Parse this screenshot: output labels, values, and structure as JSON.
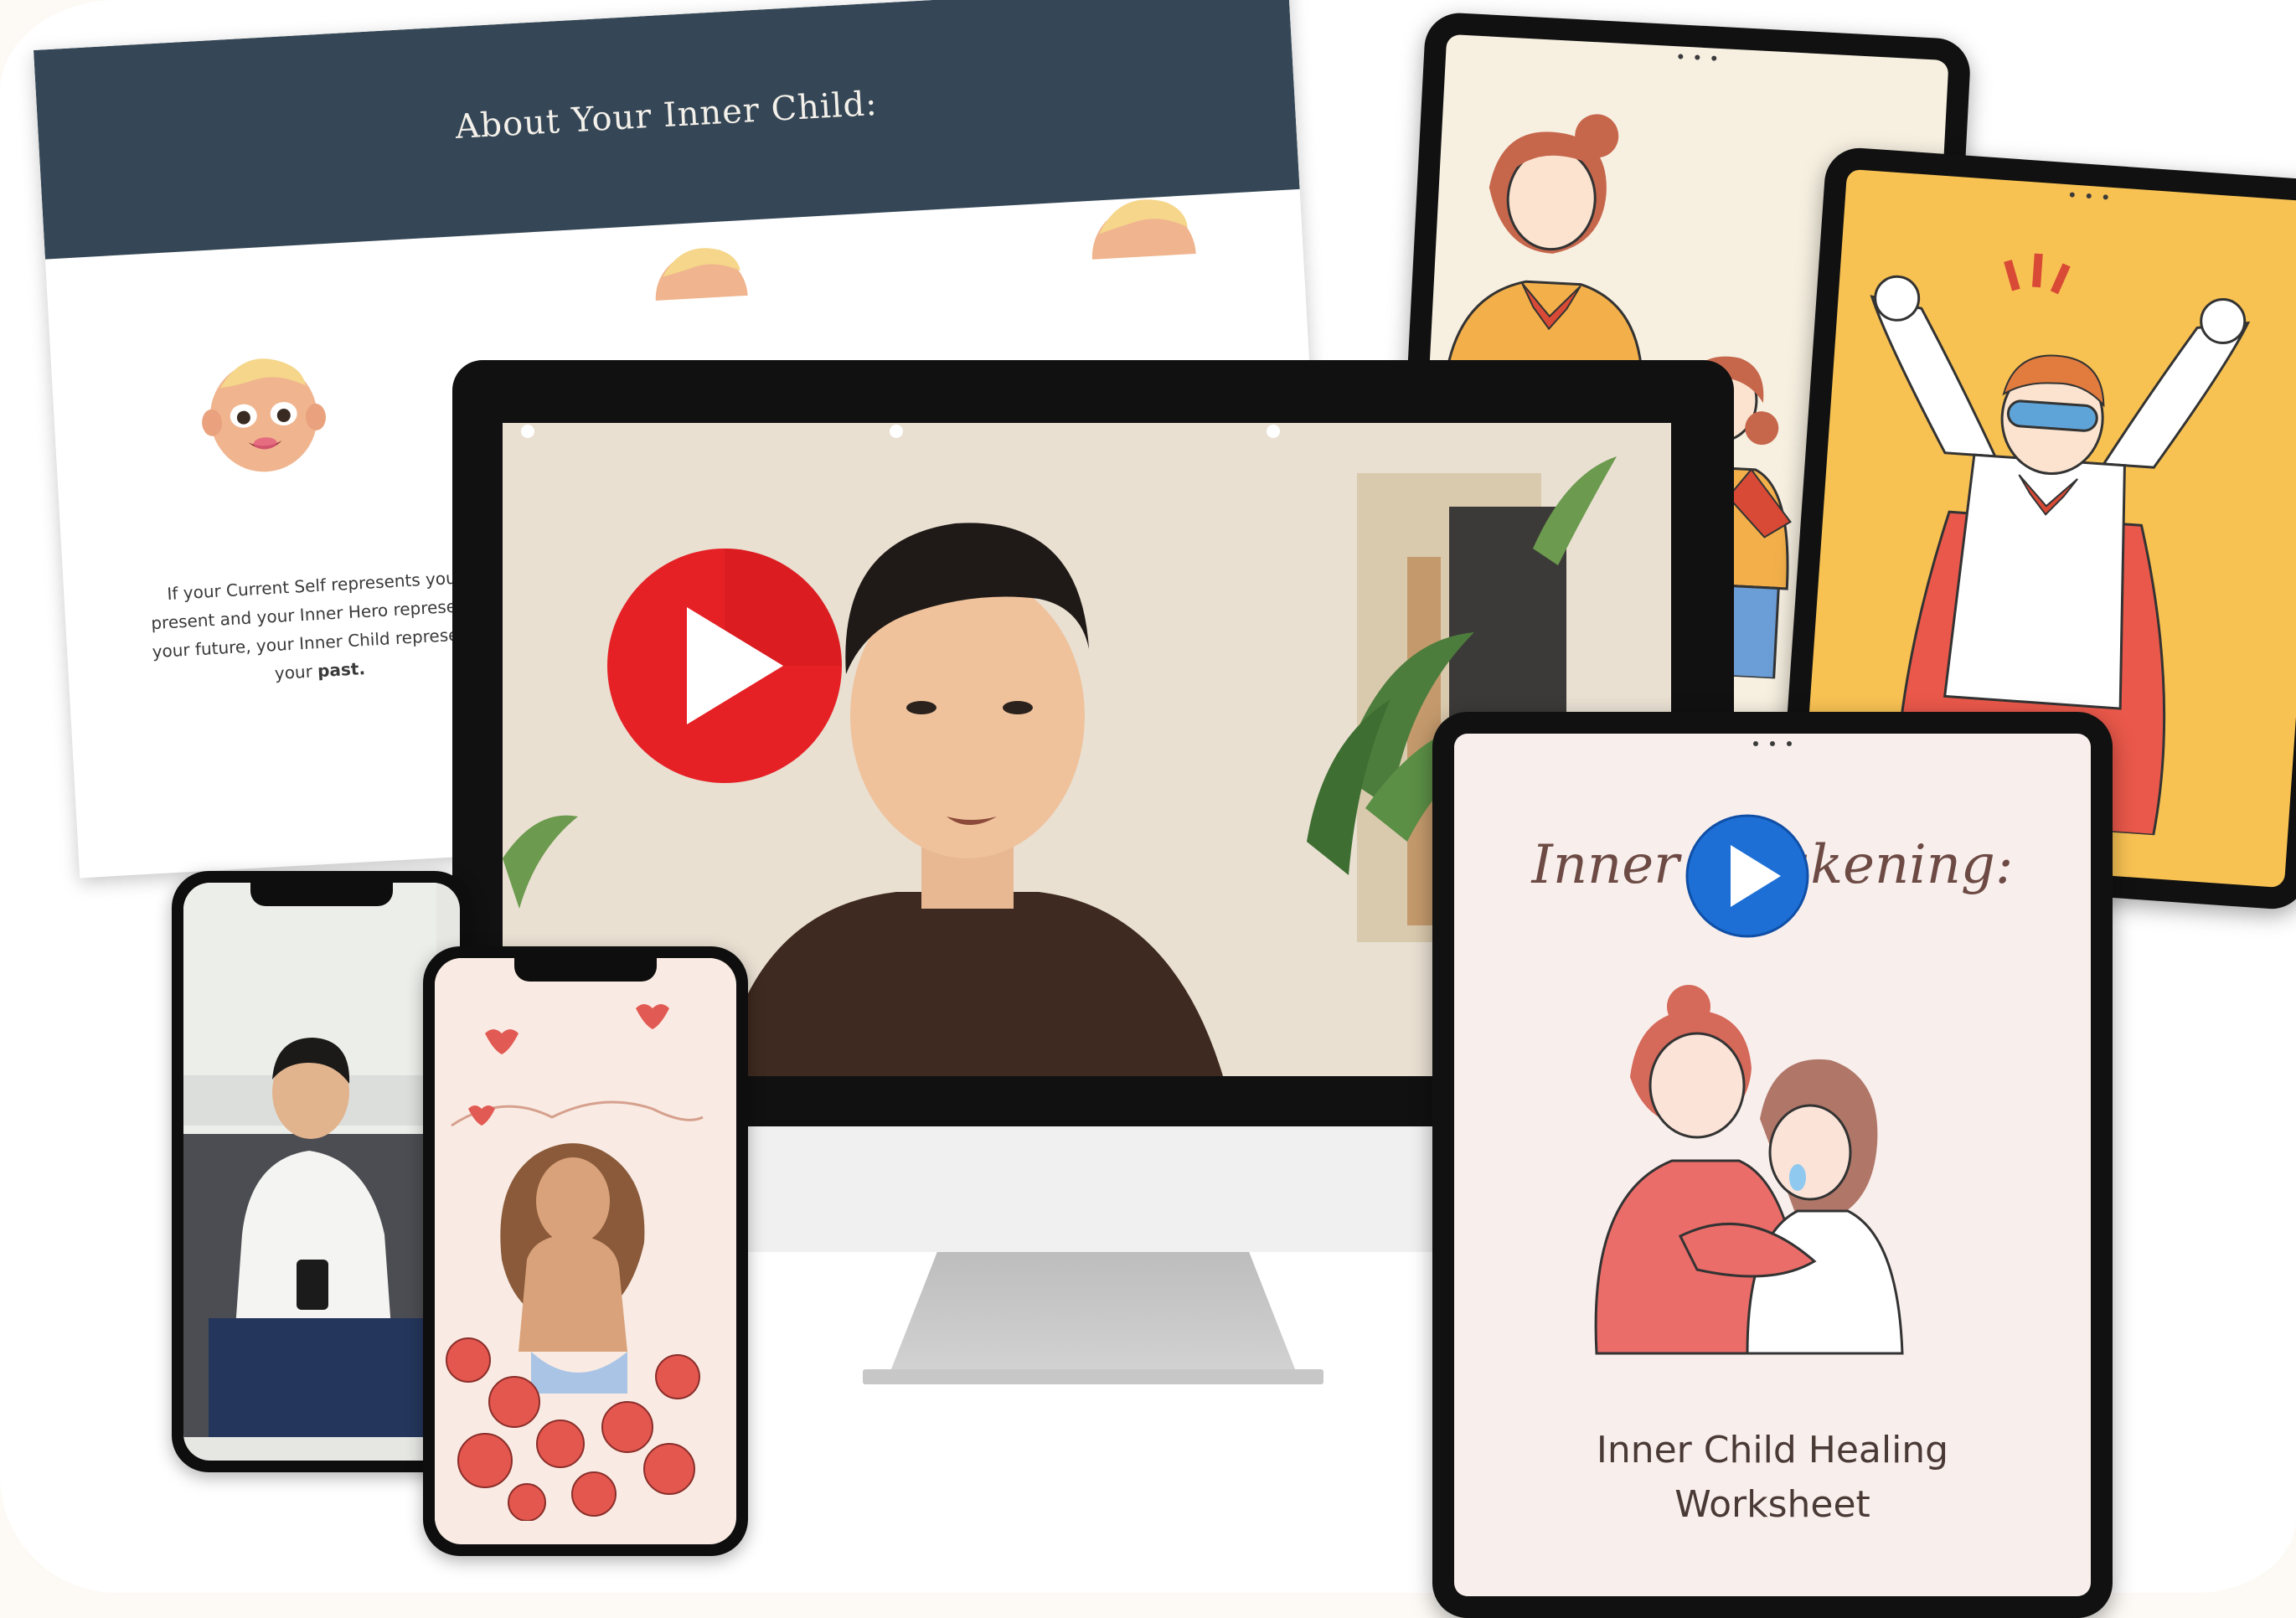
{
  "slide": {
    "title": "About Your Inner Child:",
    "text_line1": "If your Current Self represents your",
    "text_line2": "present and your Inner Hero represents",
    "text_line3": "your future, your Inner Child represents",
    "text_line4_prefix": "your ",
    "text_line4_bold": "past."
  },
  "worksheet": {
    "script_title": "Inner Awakening:",
    "title_line1": "Inner Child Healing",
    "title_line2": "Worksheet"
  },
  "icons": {
    "main_play": "play-button-red",
    "tablet_play": "play-button-blue"
  },
  "colors": {
    "slide_header": "#354756",
    "play_red": "#e52126",
    "play_blue": "#1d6fd6",
    "tablet_hero_bg": "#f8c253",
    "tablet_sisters_bg": "#f7f0e1",
    "worksheet_bg": "#f8eeec"
  }
}
